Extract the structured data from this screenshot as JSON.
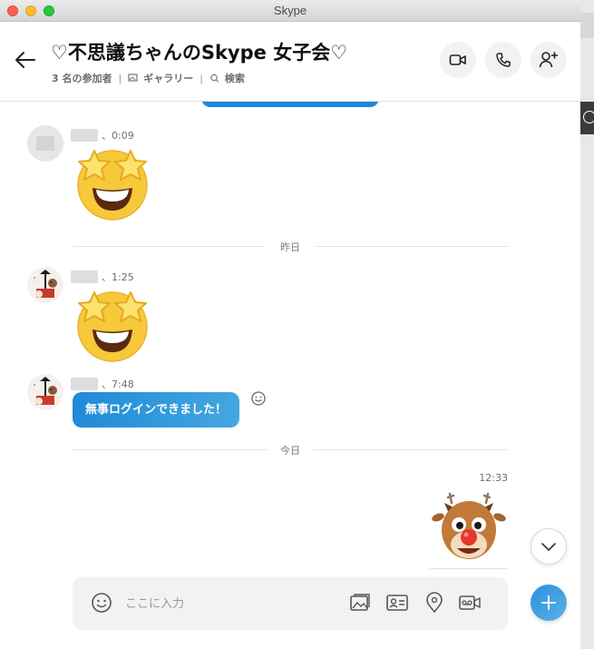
{
  "window": {
    "title": "Skype"
  },
  "header": {
    "conversation_title": "♡不思議ちゃんのSkype 女子会♡",
    "participants": "3 名の参加者",
    "gallery": "ギャラリー",
    "search": "検索"
  },
  "messages": [
    {
      "time": "、0:09",
      "content": "star-eyes-emoji"
    },
    {
      "day_divider": "昨日"
    },
    {
      "time": "、1:25",
      "content": "star-eyes-emoji"
    },
    {
      "time": "、7:48",
      "text": "無事ログインできました！"
    },
    {
      "day_divider": "今日"
    },
    {
      "time": "12:33",
      "content": "reindeer-sticker",
      "own": true
    }
  ],
  "composer": {
    "placeholder": "ここに入力"
  },
  "icons": {
    "back": "arrow-left-icon",
    "video": "video-camera-icon",
    "call": "phone-icon",
    "add_person": "add-person-icon",
    "emoji": "smiley-icon",
    "media": "image-icon",
    "contact": "contact-card-icon",
    "location": "location-pin-icon",
    "voice": "voicemail-icon",
    "scroll": "chevron-down-icon",
    "plus": "plus-icon"
  },
  "colors": {
    "accent": "#1f87d8",
    "bubble_gradient_end": "#44a7e0",
    "emoji_yellow": "#f6c83a"
  }
}
